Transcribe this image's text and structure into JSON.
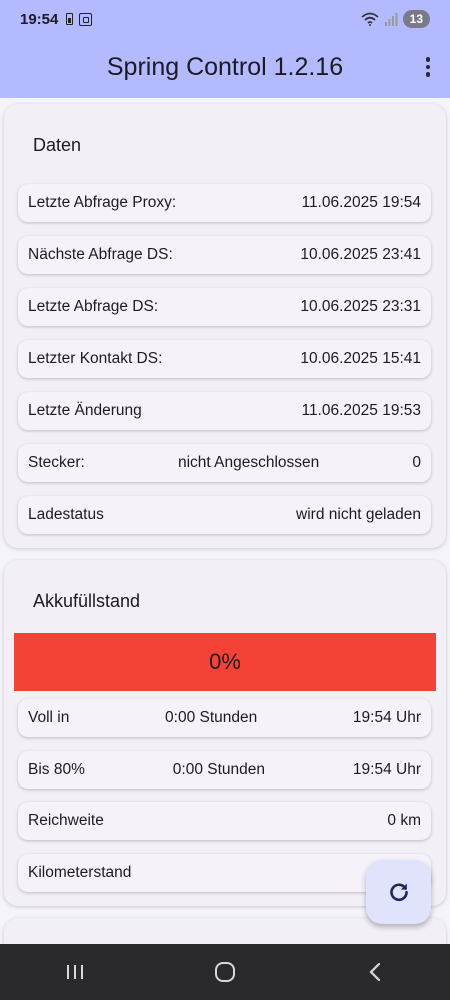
{
  "status_bar": {
    "time": "19:54",
    "battery_badge": "13",
    "icons": [
      "battery-icon",
      "screenshot-icon",
      "wifi-icon",
      "signal-icon"
    ]
  },
  "app_bar": {
    "title": "Spring Control 1.2.16",
    "menu_icon": "more-vert-icon"
  },
  "daten": {
    "title": "Daten",
    "rows": [
      {
        "label": "Letzte Abfrage Proxy:",
        "value": "11.06.2025 19:54"
      },
      {
        "label": "Nächste Abfrage DS:",
        "value": "10.06.2025 23:41"
      },
      {
        "label": "Letzte Abfrage DS:",
        "value": "10.06.2025 23:31"
      },
      {
        "label": "Letzter Kontakt DS:",
        "value": "10.06.2025 15:41"
      },
      {
        "label": "Letzte Änderung",
        "value": "11.06.2025 19:53"
      }
    ],
    "stecker": {
      "label": "Stecker:",
      "status": "nicht Angeschlossen",
      "value": "0"
    },
    "ladestatus": {
      "label": "Ladestatus",
      "value": "wird nicht geladen"
    }
  },
  "akku": {
    "title": "Akkufüllstand",
    "percent_text": "0%",
    "percent": 0,
    "bar_color": "#f44336",
    "voll_in": {
      "label": "Voll in",
      "duration": "0:00 Stunden",
      "time": "19:54 Uhr"
    },
    "bis80": {
      "label": "Bis 80%",
      "duration": "0:00 Stunden",
      "time": "19:54 Uhr"
    },
    "reichweite": {
      "label": "Reichweite",
      "value": "0 km"
    },
    "kilometerstand": {
      "label": "Kilometerstand"
    }
  },
  "fab": {
    "icon": "refresh-icon"
  },
  "nav": {
    "icons": [
      "recent-apps-icon",
      "home-icon",
      "back-icon"
    ]
  },
  "colors": {
    "header": "#b4baff",
    "background": "#f6f4fb",
    "fab": "#e1e2fb",
    "nav_bar": "#2a2a2d"
  }
}
